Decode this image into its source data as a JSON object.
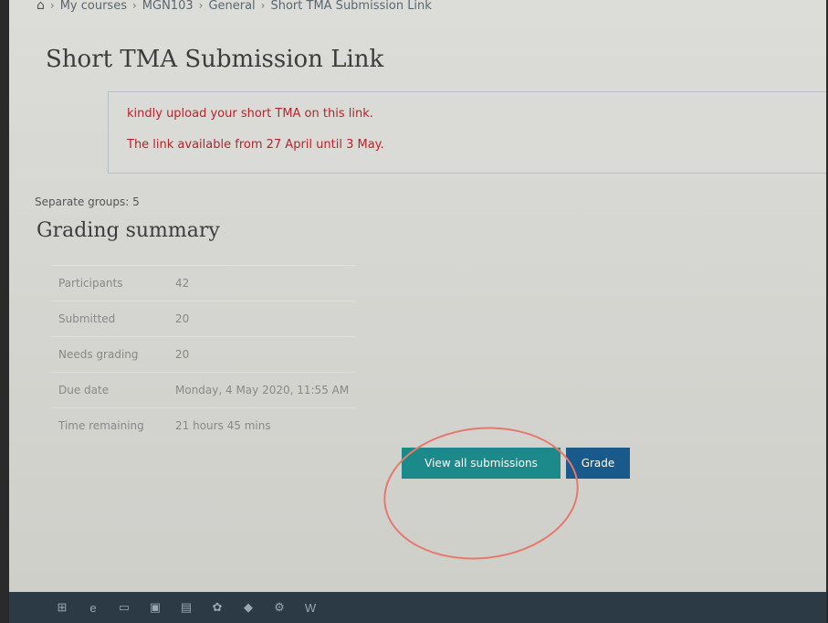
{
  "breadcrumb": {
    "items": [
      "My courses",
      "MGN103",
      "General",
      "Short TMA Submission Link"
    ]
  },
  "page": {
    "title": "Short TMA Submission Link"
  },
  "intro": {
    "line1": "kindly upload your short TMA on this link.",
    "line2": "The link available from 27 April until 3 May."
  },
  "groups_label": "Separate groups: 5",
  "summary": {
    "heading": "Grading summary",
    "rows": [
      {
        "label": "Participants",
        "value": "42"
      },
      {
        "label": "Submitted",
        "value": "20"
      },
      {
        "label": "Needs grading",
        "value": "20"
      },
      {
        "label": "Due date",
        "value": "Monday, 4 May 2020, 11:55 AM"
      },
      {
        "label": "Time remaining",
        "value": "21 hours 45 mins"
      }
    ]
  },
  "actions": {
    "view_all": "View all submissions",
    "grade": "Grade"
  },
  "colors": {
    "intro_text": "#b8242b",
    "view_button": "#1c8a8a",
    "grade_button": "#1a5a8a",
    "annotation_circle": "#e6796d"
  },
  "taskbar": {
    "icons": [
      "windows-icon",
      "edge-icon",
      "task-view-icon",
      "store-icon",
      "files-icon",
      "photos-icon",
      "app-icon",
      "settings-icon",
      "word-icon"
    ]
  }
}
